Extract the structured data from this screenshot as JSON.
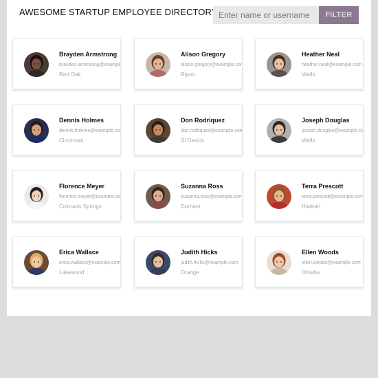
{
  "header": {
    "title": "AWESOME STARTUP EMPLOYEE DIRECTORY",
    "search_placeholder": "Enter name or username",
    "search_value": "",
    "filter_label": "FILTER"
  },
  "colors": {
    "accent": "#8b7a8f",
    "page_background": "#dcdcdc",
    "muted_text": "#a2a2a2"
  },
  "employees": [
    {
      "name": "Brayden Armstrong",
      "email": "brayden.armstrong@example.com",
      "city": "Red Oak",
      "avatar": {
        "bg": "#4a3a35",
        "skin": "#7a5040",
        "hair": "#1a1210",
        "shirt": "#2a2a2a"
      }
    },
    {
      "name": "Alison Gregory",
      "email": "alison.gregory@example.com",
      "city": "Ripon",
      "avatar": {
        "bg": "#c9b6a8",
        "skin": "#e0b49a",
        "hair": "#6b3b2a",
        "shirt": "#b06a6a"
      }
    },
    {
      "name": "Heather Neal",
      "email": "heather.neal@example.com",
      "city": "Wells",
      "avatar": {
        "bg": "#9c948c",
        "skin": "#e6c3a8",
        "hair": "#4a2e22",
        "shirt": "#5b5050"
      }
    },
    {
      "name": "Dennis Holmes",
      "email": "dennis.holmes@example.com",
      "city": "Cincinnati",
      "avatar": {
        "bg": "#2a2e55",
        "skin": "#d4a080",
        "hair": "#2a1a12",
        "shirt": "#1e2a6a"
      }
    },
    {
      "name": "Don Rodriquez",
      "email": "don.rodriquez@example.com",
      "city": "St Davids",
      "avatar": {
        "bg": "#5b4632",
        "skin": "#c98a5e",
        "hair": "#2a1c12",
        "shirt": "#3a3a3a"
      }
    },
    {
      "name": "Joseph Douglas",
      "email": "joseph.douglas@example.com",
      "city": "Wells",
      "avatar": {
        "bg": "#b0b0b0",
        "skin": "#e3bfa2",
        "hair": "#2e241c",
        "shirt": "#3c3c3c"
      }
    },
    {
      "name": "Florence Meyer",
      "email": "florence.meyer@example.com",
      "city": "Colorado Springs",
      "avatar": {
        "bg": "#eaeaea",
        "skin": "#f0d2bc",
        "hair": "#2a1e18",
        "shirt": "#f4f4f4"
      }
    },
    {
      "name": "Suzanna Ross",
      "email": "suzanna.ross@example.com",
      "city": "Durham",
      "avatar": {
        "bg": "#6f5a4c",
        "skin": "#e0ae92",
        "hair": "#3a2418",
        "shirt": "#8a4a4a"
      }
    },
    {
      "name": "Terra Prescott",
      "email": "terra.prescott@example.com",
      "city": "Hialeah",
      "avatar": {
        "bg": "#c0482f",
        "skin": "#e7b58e",
        "hair": "#8a5a2a",
        "shirt": "#b4302a"
      }
    },
    {
      "name": "Erica Wallace",
      "email": "erica.wallace@example.com",
      "city": "Lakewood",
      "avatar": {
        "bg": "#6d4a35",
        "skin": "#eec79e",
        "hair": "#d8b060",
        "shirt": "#2a3a6a"
      }
    },
    {
      "name": "Judith Hicks",
      "email": "judith.hicks@example.com",
      "city": "Orange",
      "avatar": {
        "bg": "#3a4a6a",
        "skin": "#e4c0a8",
        "hair": "#3a2a22",
        "shirt": "#33405a"
      }
    },
    {
      "name": "Ellen Woods",
      "email": "ellen.woods@example.com",
      "city": "Omaha",
      "avatar": {
        "bg": "#e8ddd4",
        "skin": "#f0c8aa",
        "hair": "#a0482a",
        "shirt": "#c4b8a8"
      }
    }
  ]
}
